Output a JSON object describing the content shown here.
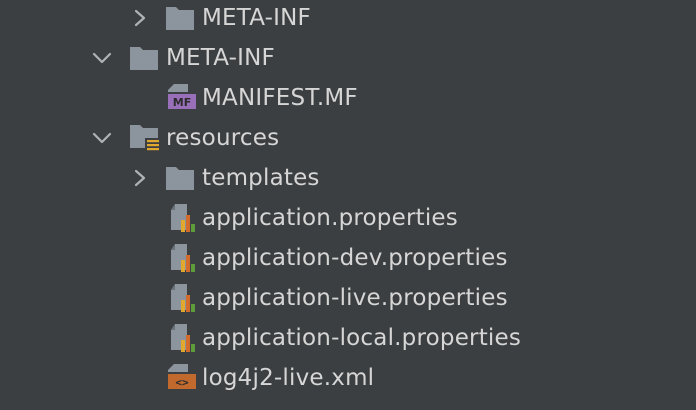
{
  "tree": {
    "items": [
      {
        "label": "META-INF",
        "icon": "folder-icon",
        "state": "collapsed"
      },
      {
        "label": "META-INF",
        "icon": "folder-icon",
        "state": "expanded"
      },
      {
        "label": "MANIFEST.MF",
        "icon": "manifest-file-icon",
        "badge": "MF"
      },
      {
        "label": "resources",
        "icon": "resources-folder-icon",
        "state": "expanded"
      },
      {
        "label": "templates",
        "icon": "folder-icon",
        "state": "collapsed"
      },
      {
        "label": "application.properties",
        "icon": "properties-file-icon"
      },
      {
        "label": "application-dev.properties",
        "icon": "properties-file-icon"
      },
      {
        "label": "application-live.properties",
        "icon": "properties-file-icon"
      },
      {
        "label": "application-local.properties",
        "icon": "properties-file-icon"
      },
      {
        "label": "log4j2-live.xml",
        "icon": "xml-file-icon",
        "badge": "<>"
      }
    ]
  },
  "colors": {
    "background": "#3c3f41",
    "text": "#d6d6d6",
    "folder": "#8c959d",
    "chevron": "#b0b3b6",
    "manifest_badge": "#9a6fb9",
    "xml_badge": "#c26a2d",
    "properties_bars": [
      "#e0a82e",
      "#d26b2b",
      "#5e9c3a"
    ]
  }
}
